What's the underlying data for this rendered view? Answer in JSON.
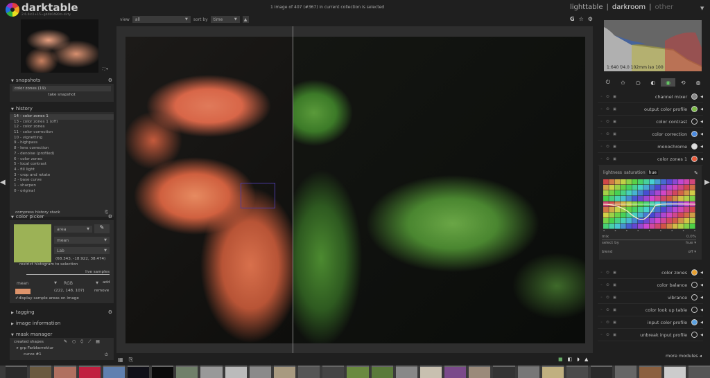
{
  "app": {
    "name": "darktable",
    "version": "2.6.0rc2+15~gd4b0480m-dirty"
  },
  "status": "1 image of 407 (#367) in current collection is selected",
  "views": {
    "items": [
      "lighttable",
      "darkroom",
      "other"
    ],
    "active": "darkroom",
    "separator": "|"
  },
  "top_filter": {
    "view_label": "view",
    "view_value": "all",
    "sort_label": "sort by",
    "sort_value": "time",
    "sort_dir": "▲"
  },
  "top_icons": [
    "G",
    "☆",
    "⚙"
  ],
  "left": {
    "snapshots": {
      "title": "snapshots",
      "item": "color zones (19)",
      "button": "take snapshot"
    },
    "history": {
      "title": "history",
      "items": [
        "14 - color zones 1",
        "13 - color zones 1 (off)",
        "12 - color zones",
        "11 - color correction",
        "10 - vignetting",
        "9 - highpass",
        "8 - lens correction",
        "7 - denoise (profiled)",
        "6 - color zones",
        "5 - local contrast",
        "4 - fill light",
        "3 - crop and rotate",
        "2 - base curve",
        "1 - sharpen",
        "0 - original"
      ],
      "compress": "compress history stack"
    },
    "color_picker": {
      "title": "color picker",
      "swatch_color": "#9cb256",
      "mode": "area",
      "stat": "mean",
      "space": "Lab",
      "values": "(68.343, -18.922, 38.474)",
      "restrict": "restrict histogram to selection",
      "live_samples": "live samples",
      "sample_stat": "mean",
      "sample_space": "RGB",
      "add": "add",
      "sample_color": "#de946b",
      "sample_values": "(222, 148, 107)",
      "remove": "remove",
      "display_areas": "display sample areas on image"
    },
    "tagging": {
      "title": "tagging"
    },
    "image_information": {
      "title": "image information"
    },
    "mask_manager": {
      "title": "mask manager",
      "created_shapes": "created shapes",
      "group": "grp Farbkorrektur",
      "curve": "curve #1"
    }
  },
  "right": {
    "histogram_info": "1:640 f/4.0 102mm iso 100",
    "groups": [
      "power",
      "favorites",
      "basic",
      "tone",
      "color",
      "correct",
      "effect"
    ],
    "active_group": "color",
    "modules_top": [
      {
        "name": "channel mixer",
        "icon_color": "#888"
      },
      {
        "name": "output color profile",
        "icon_color": "#7aba44"
      },
      {
        "name": "color contrast",
        "icon_color": "transparent"
      },
      {
        "name": "color correction",
        "icon_color": "#4a8ae0"
      },
      {
        "name": "monochrome",
        "icon_color": "#ddd"
      },
      {
        "name": "color zones 1",
        "icon_color": "#e85a3a"
      }
    ],
    "color_zones": {
      "tabs": [
        "lightness",
        "saturation",
        "hue"
      ],
      "active_tab": "hue",
      "mix_label": "mix",
      "mix_value": "0.0%",
      "select_by_label": "select by",
      "select_by_value": "hue",
      "blend_label": "blend",
      "blend_value": "off"
    },
    "modules_bottom": [
      {
        "name": "color zones",
        "icon_color": "#e8a030"
      },
      {
        "name": "color balance",
        "icon_color": "transparent"
      },
      {
        "name": "vibrance",
        "icon_color": "transparent"
      },
      {
        "name": "color look up table",
        "icon_color": "transparent"
      },
      {
        "name": "input color profile",
        "icon_color": "#5aa0e0"
      },
      {
        "name": "unbreak input profile",
        "icon_color": "transparent"
      }
    ],
    "more_modules": "more modules"
  }
}
